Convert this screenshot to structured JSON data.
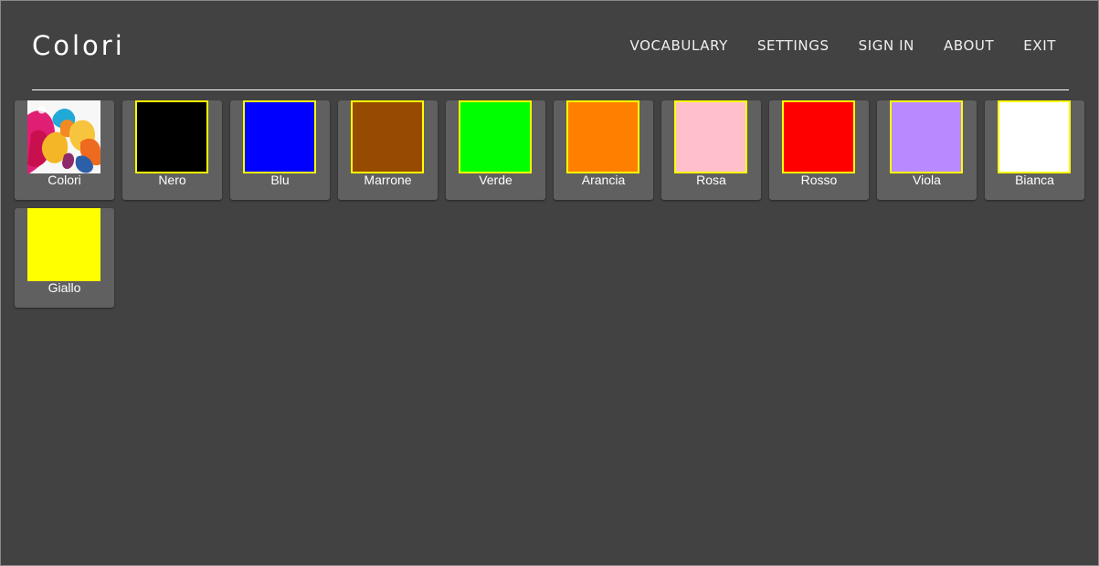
{
  "header": {
    "title": "Colori",
    "nav": [
      "VOCABULARY",
      "SETTINGS",
      "SIGN IN",
      "ABOUT",
      "EXIT"
    ]
  },
  "cards": [
    {
      "label": "Colori",
      "color": "#ffffff",
      "icon": "ink-splash-image"
    },
    {
      "label": "Nero",
      "color": "#000000"
    },
    {
      "label": "Blu",
      "color": "#0000ff"
    },
    {
      "label": "Marrone",
      "color": "#964b00"
    },
    {
      "label": "Verde",
      "color": "#00ff00"
    },
    {
      "label": "Arancia",
      "color": "#ff8000"
    },
    {
      "label": "Rosa",
      "color": "#ffc0cb"
    },
    {
      "label": "Rosso",
      "color": "#ff0000"
    },
    {
      "label": "Viola",
      "color": "#b98aff"
    },
    {
      "label": "Bianca",
      "color": "#ffffff"
    },
    {
      "label": "Giallo",
      "color": "#ffff00"
    }
  ],
  "theme": {
    "background": "#424242",
    "card": "#606060",
    "swatch_border": "#ffff00"
  }
}
